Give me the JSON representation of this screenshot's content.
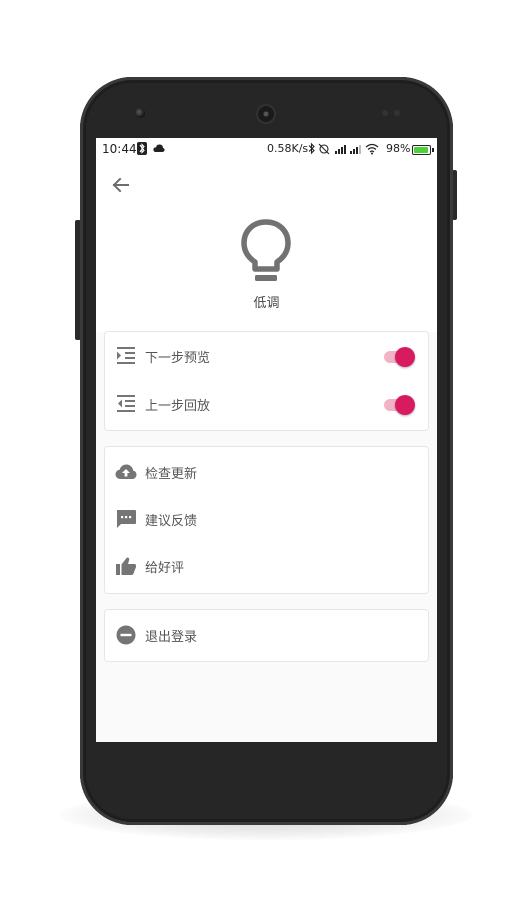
{
  "status_bar": {
    "time": "10:44",
    "speed": "0.58K/s",
    "battery": "98%"
  },
  "header": {
    "mode_label": "低调"
  },
  "settings": {
    "toggles": [
      {
        "label": "下一步预览",
        "icon": "indent-increase-icon",
        "on": true
      },
      {
        "label": "上一步回放",
        "icon": "indent-decrease-icon",
        "on": true
      }
    ],
    "actions": [
      {
        "label": "检查更新",
        "icon": "cloud-upload-icon"
      },
      {
        "label": "建议反馈",
        "icon": "feedback-chat-icon"
      },
      {
        "label": "给好评",
        "icon": "thumb-up-icon"
      }
    ],
    "logout": {
      "label": "退出登录",
      "icon": "remove-circle-icon"
    }
  },
  "colors": {
    "accent": "#d81b60",
    "accent_track": "#f3b3c7",
    "icon_gray": "#757575",
    "background": "#fafafa"
  }
}
